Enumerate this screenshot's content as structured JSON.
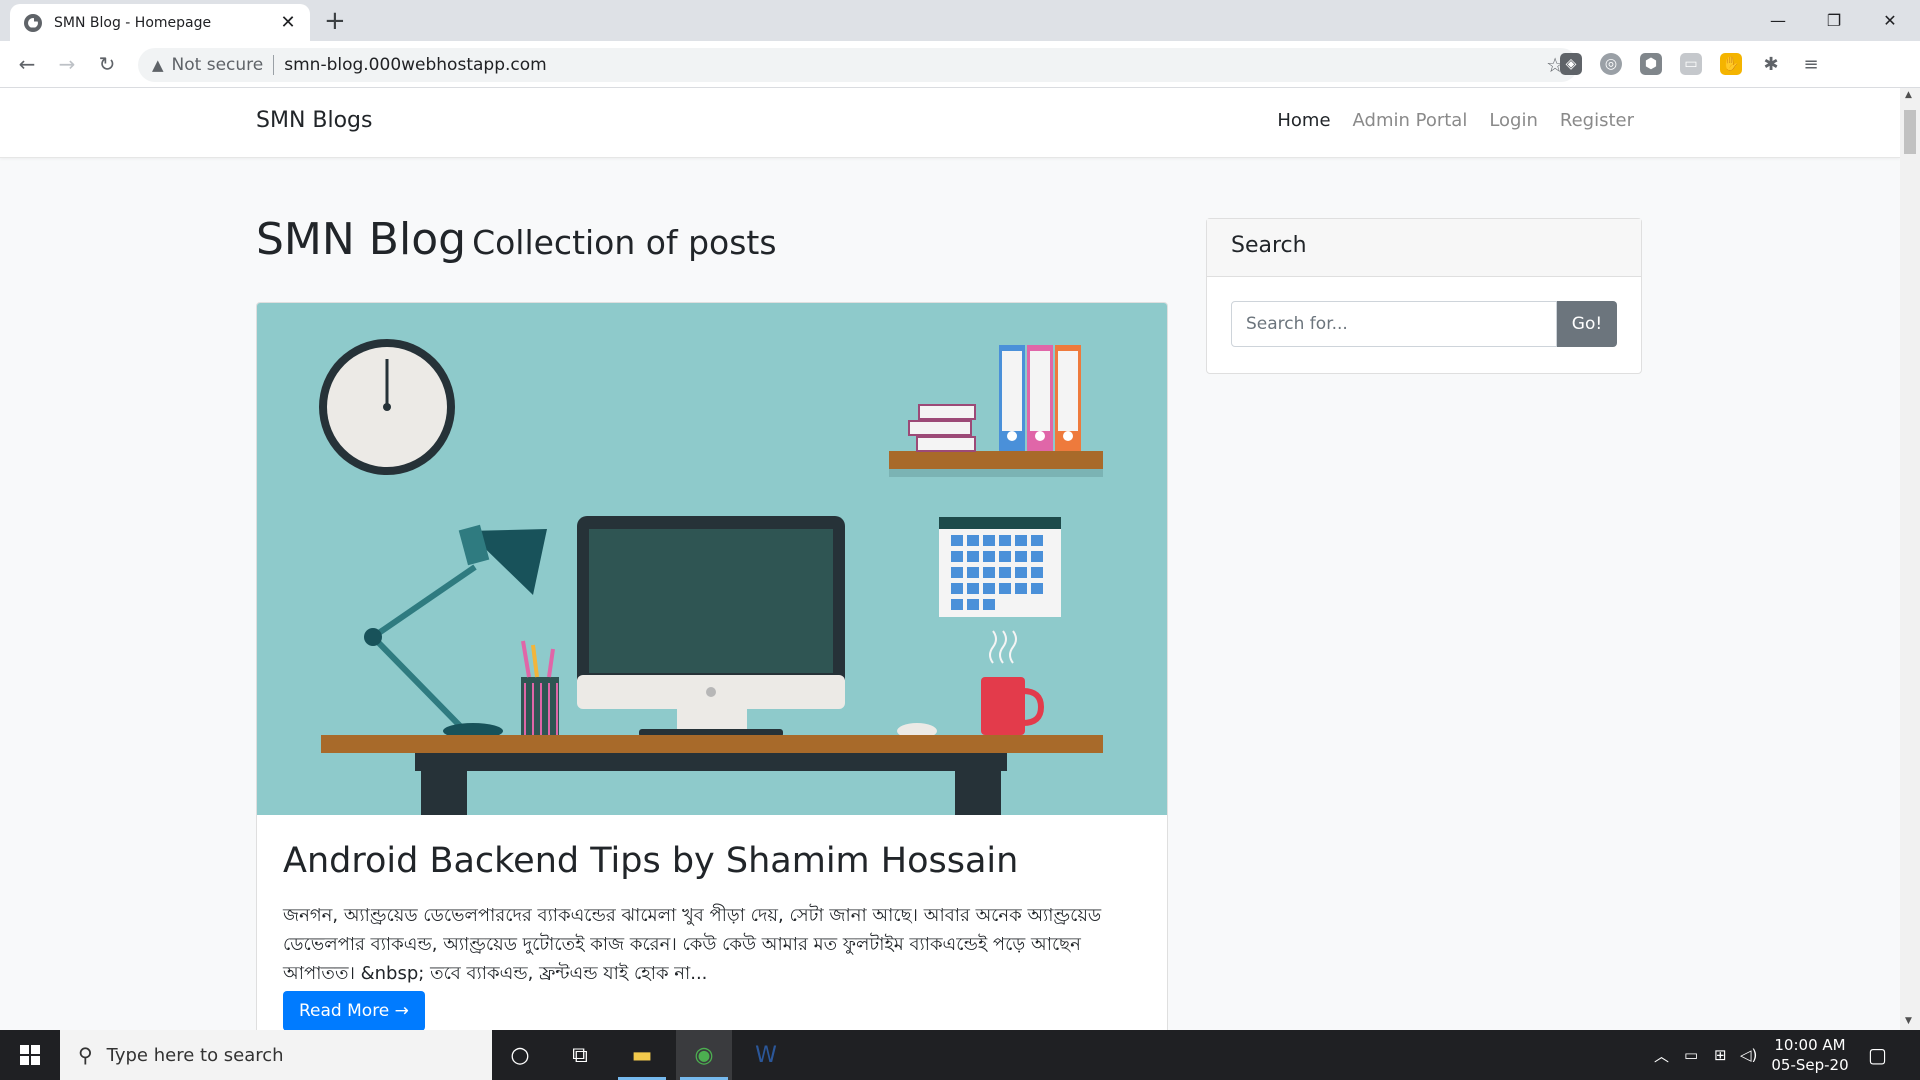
{
  "browser": {
    "tab_title": "SMN Blog - Homepage",
    "tab_close": "✕",
    "new_tab": "+",
    "window_minimize": "—",
    "window_restore": "❐",
    "window_close": "✕",
    "back": "←",
    "forward": "→",
    "reload": "↻",
    "security_label": "Not secure",
    "url": "smn-blog.000webhostapp.com",
    "bookmark_star": "☆",
    "menu": "⋮"
  },
  "site": {
    "brand": "SMN Blogs",
    "nav": {
      "home": "Home",
      "admin": "Admin Portal",
      "login": "Login",
      "register": "Register"
    },
    "heading_big": "SMN Blog",
    "heading_small": "Collection of posts"
  },
  "post": {
    "title": "Android Backend Tips by Shamim Hossain",
    "excerpt": "জনগন, অ্যাণ্ড্রয়েড ডেভেলপারদের ব্যাকএন্ডের ঝামেলা খুব পীড়া দেয়, সেটা জানা আছে। আবার অনেক অ্যাণ্ড্রয়েড ডেভেলপার ব্যাকএন্ড, অ্যাণ্ড্রয়েড দুটোতেই কাজ করেন। কেউ কেউ আমার মত ফুলটাইম ব্যাকএন্ডেই পড়ে আছেন আপাতত। &nbsp; তবে ব্যাকএন্ড, ফ্রন্টএন্ড যাই হোক না...",
    "read_more": "Read More →"
  },
  "sidebar": {
    "search_title": "Search",
    "search_placeholder": "Search for...",
    "go_label": "Go!"
  },
  "taskbar": {
    "search_placeholder": "Type here to search",
    "time": "10:00 AM",
    "date": "05-Sep-20"
  },
  "colors": {
    "accent": "#007bff",
    "go_button": "#6c757d",
    "image_bg": "#8ecacb"
  }
}
